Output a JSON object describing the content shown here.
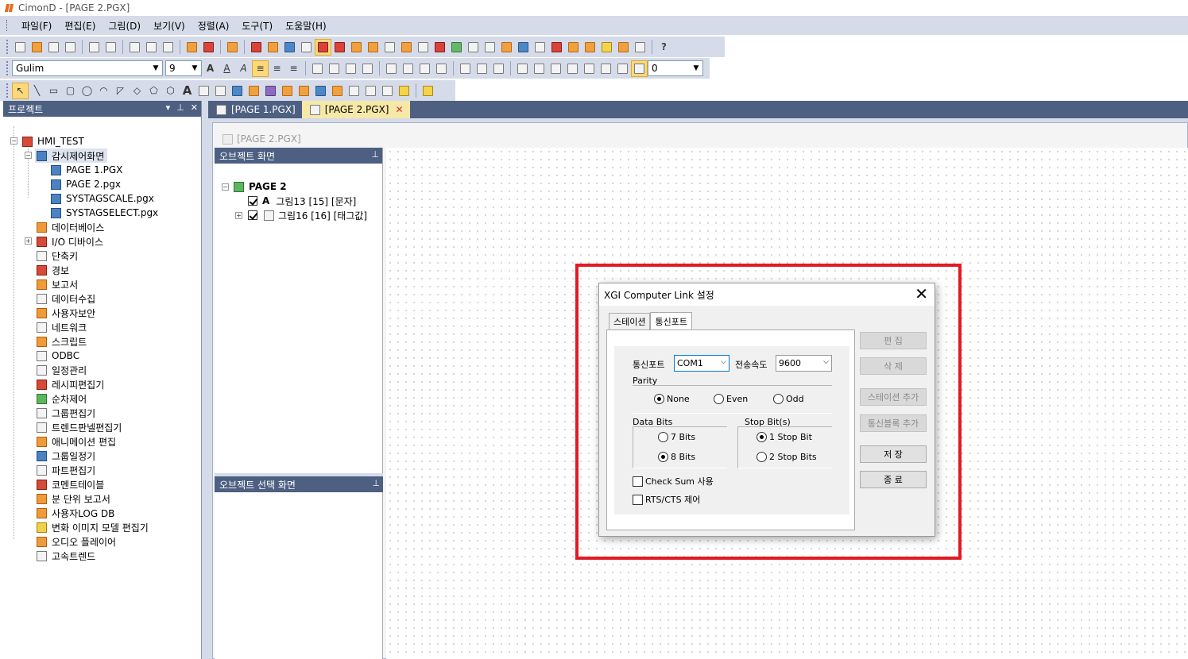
{
  "window": {
    "title": "CimonD - [PAGE 2.PGX]"
  },
  "menu": [
    "파일(F)",
    "편집(E)",
    "그림(D)",
    "보기(V)",
    "정렬(A)",
    "도구(T)",
    "도움말(H)"
  ],
  "font_toolbar": {
    "font": "Gulim",
    "size": "9",
    "bold_label": "A",
    "line_width": "0"
  },
  "project_panel": {
    "title": "프로젝트",
    "root": "HMI_TEST",
    "screens_folder": "감시제어화면",
    "pages": [
      "PAGE 1.PGX",
      "PAGE 2.pgx",
      "SYSTAGSCALE.pgx",
      "SYSTAGSELECT.pgx"
    ],
    "items": [
      "데이터베이스",
      "I/O 디바이스",
      "단축키",
      "경보",
      "보고서",
      "데이터수집",
      "사용자보안",
      "네트워크",
      "스크립트",
      "ODBC",
      "일정관리",
      "레시피편집기",
      "순차제어",
      "그룹편집기",
      "트렌드판넬편집기",
      "애니메이션 편집",
      "그룹일정기",
      "파트편집기",
      "코멘트테이블",
      "분 단위 보고서",
      "사용자LOG DB",
      "변화 이미지 모델 편집기",
      "오디오 플레이어",
      "고속트렌드"
    ]
  },
  "tabs": [
    {
      "label": "[PAGE 1.PGX]",
      "active": false
    },
    {
      "label": "[PAGE 2.PGX]",
      "active": true
    }
  ],
  "doc": {
    "title": "[PAGE 2.PGX]"
  },
  "object_panel": {
    "title": "오브젝트 화면",
    "page": "PAGE 2",
    "objects": [
      {
        "icon": "A",
        "label": "그림13 [15] [문자]"
      },
      {
        "icon": "tag",
        "label": "그림16 [16] [태그값]"
      }
    ],
    "select_title": "오브젝트 선택 화면"
  },
  "dialog": {
    "title": "XGI Computer Link 설정",
    "tabs": [
      "스테이션",
      "통신포트"
    ],
    "active_tab": "통신포트",
    "port_label": "통신포트",
    "port_value": "COM1",
    "baud_label": "전송속도",
    "baud_value": "9600",
    "parity_label": "Parity",
    "parity_options": [
      "None",
      "Even",
      "Odd"
    ],
    "parity_selected": "None",
    "databits_label": "Data Bits",
    "databits_options": [
      "7 Bits",
      "8 Bits"
    ],
    "databits_selected": "8 Bits",
    "stopbits_label": "Stop Bit(s)",
    "stopbits_options": [
      "1 Stop Bit",
      "2 Stop Bits"
    ],
    "stopbits_selected": "1 Stop Bit",
    "checksum_label": "Check Sum 사용",
    "rtscts_label": "RTS/CTS 제어",
    "buttons": {
      "edit": "편 집",
      "delete": "삭 제",
      "add_station": "스테이션 추가",
      "add_block": "통신블록 추가",
      "save": "저 장",
      "close": "종 료"
    }
  },
  "colors": {
    "highlight_box": "#e01b24",
    "panel_header": "#4d6082",
    "toolbar_bg": "#d6dbe9",
    "active_tab": "#f6e9a8"
  }
}
